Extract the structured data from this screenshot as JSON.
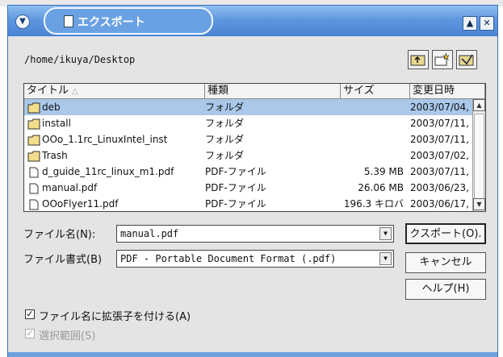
{
  "window": {
    "title": "エクスポート",
    "path": "/home/ikuya/Desktop"
  },
  "file_list": {
    "columns": [
      "タイトル",
      "種類",
      "サイズ",
      "変更日時"
    ],
    "rows": [
      {
        "icon": "folder-icon",
        "name": "deb",
        "type": "フォルダ",
        "size": "",
        "date": "2003/07/04,",
        "selected": true
      },
      {
        "icon": "folder-icon",
        "name": "install",
        "type": "フォルダ",
        "size": "",
        "date": "2003/07/11,",
        "selected": false
      },
      {
        "icon": "folder-icon",
        "name": "OOo_1.1rc_LinuxIntel_inst",
        "type": "フォルダ",
        "size": "",
        "date": "2003/07/11,",
        "selected": false
      },
      {
        "icon": "folder-icon",
        "name": "Trash",
        "type": "フォルダ",
        "size": "",
        "date": "2003/07/02,",
        "selected": false
      },
      {
        "icon": "file-icon",
        "name": "d_guide_11rc_linux_m1.pdf",
        "type": "PDF-ファイル",
        "size": "5.39 MB",
        "date": "2003/07/11,",
        "selected": false
      },
      {
        "icon": "file-icon",
        "name": "manual.pdf",
        "type": "PDF-ファイル",
        "size": "26.06 MB",
        "date": "2003/06/23,",
        "selected": false
      },
      {
        "icon": "file-icon",
        "name": "OOoFlyer11.pdf",
        "type": "PDF-ファイル",
        "size": "196.3 キロバ",
        "date": "2003/06/17,",
        "selected": false
      }
    ]
  },
  "form": {
    "filename_label": "ファイル名(N):",
    "filename_value": "manual.pdf",
    "filetype_label": "ファイル書式(B)",
    "filetype_value": "PDF - Portable Document Format (.pdf)"
  },
  "buttons": {
    "export": "クスポート(O).",
    "cancel": "キャンセル",
    "help": "ヘルプ(H)"
  },
  "options": {
    "extension_label": "ファイル名に拡張子を付ける(A)",
    "extension_checked": true,
    "selection_label": "選択範囲(S)",
    "selection_checked": true,
    "selection_enabled": false
  }
}
